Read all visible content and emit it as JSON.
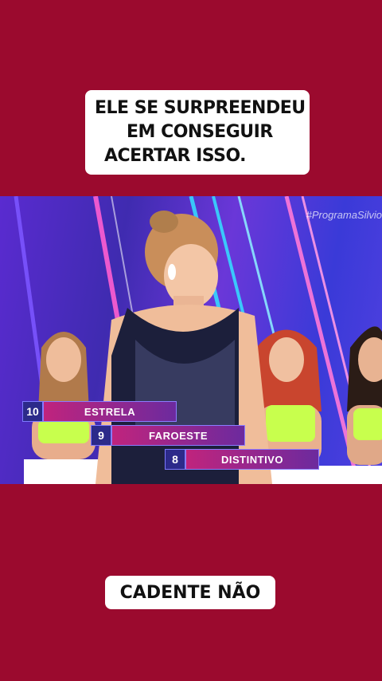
{
  "caption_top": {
    "line1": "ELE SE SURPREENDEU",
    "line2": "EM CONSEGUIR",
    "line3": "ACERTAR ISSO."
  },
  "video": {
    "watermark": "#ProgramaSilvio",
    "answers": [
      {
        "number": "10",
        "word": "ESTRELA"
      },
      {
        "number": "9",
        "word": "FAROESTE"
      },
      {
        "number": "8",
        "word": "DISTINTIVO"
      }
    ]
  },
  "caption_bottom": {
    "text": "CADENTE NÃO"
  },
  "colors": {
    "background": "#9b0a2e",
    "caption_bg": "#ffffff",
    "board_number_bg": "#2c2a8a",
    "board_word_bg": "#c0247d",
    "top_neon": "#00e5ff"
  }
}
